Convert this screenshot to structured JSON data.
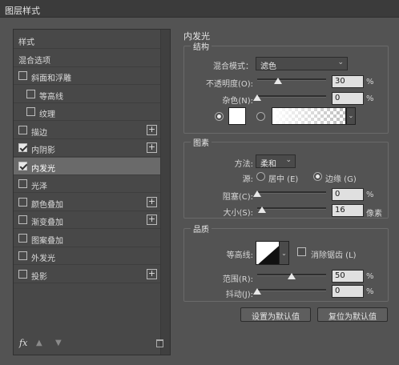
{
  "window": {
    "title": "图层样式"
  },
  "left_panel": {
    "items": [
      {
        "label": "样式",
        "checkbox": false,
        "checked": false,
        "plus": false,
        "indent": 0
      },
      {
        "label": "混合选项",
        "checkbox": false,
        "checked": false,
        "plus": false,
        "indent": 0
      },
      {
        "label": "斜面和浮雕",
        "checkbox": true,
        "checked": false,
        "plus": false,
        "indent": 0
      },
      {
        "label": "等高线",
        "checkbox": true,
        "checked": false,
        "plus": false,
        "indent": 1
      },
      {
        "label": "纹理",
        "checkbox": true,
        "checked": false,
        "plus": false,
        "indent": 1
      },
      {
        "label": "描边",
        "checkbox": true,
        "checked": false,
        "plus": true,
        "indent": 0
      },
      {
        "label": "内阴影",
        "checkbox": true,
        "checked": true,
        "plus": true,
        "indent": 0
      },
      {
        "label": "内发光",
        "checkbox": true,
        "checked": true,
        "plus": false,
        "indent": 0,
        "selected": true
      },
      {
        "label": "光泽",
        "checkbox": true,
        "checked": false,
        "plus": false,
        "indent": 0
      },
      {
        "label": "颜色叠加",
        "checkbox": true,
        "checked": false,
        "plus": true,
        "indent": 0
      },
      {
        "label": "渐变叠加",
        "checkbox": true,
        "checked": false,
        "plus": true,
        "indent": 0
      },
      {
        "label": "图案叠加",
        "checkbox": true,
        "checked": false,
        "plus": false,
        "indent": 0
      },
      {
        "label": "外发光",
        "checkbox": true,
        "checked": false,
        "plus": false,
        "indent": 0
      },
      {
        "label": "投影",
        "checkbox": true,
        "checked": false,
        "plus": true,
        "indent": 0
      }
    ],
    "footer": {
      "fx_label": "fx"
    }
  },
  "inner_glow": {
    "title": "内发光",
    "structure": {
      "legend": "结构",
      "blend_mode_label": "混合模式：",
      "blend_mode_value": "滤色",
      "opacity_label": "不透明度(O):",
      "opacity_value": "30",
      "opacity_unit": "%",
      "noise_label": "杂色(N):",
      "noise_value": "0",
      "noise_unit": "%",
      "color_swatch": "#ffffff"
    },
    "elements": {
      "legend": "图素",
      "technique_label": "方法:",
      "technique_value": "柔和",
      "source_label": "源:",
      "source_center_label": "居中 (E)",
      "source_edge_label": "边缘 (G)",
      "source_selected": "edge",
      "choke_label": "阻塞(C):",
      "choke_value": "0",
      "choke_unit": "%",
      "size_label": "大小(S):",
      "size_value": "16",
      "size_unit": "像素"
    },
    "quality": {
      "legend": "品质",
      "contour_label": "等高线:",
      "anti_alias_label": "消除锯齿 (L)",
      "anti_alias_checked": false,
      "range_label": "范围(R):",
      "range_value": "50",
      "range_unit": "%",
      "jitter_label": "抖动(J):",
      "jitter_value": "0",
      "jitter_unit": "%"
    },
    "buttons": {
      "make_default": "设置为默认值",
      "reset_default": "复位为默认值"
    }
  },
  "colors": {
    "accent_selected": "#6a6a6a",
    "panel_bg": "#535353"
  }
}
